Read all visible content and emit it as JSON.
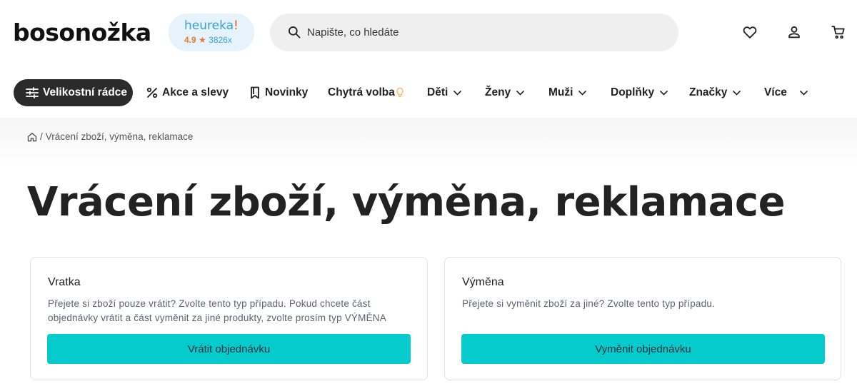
{
  "header": {
    "logo": "bosonožka",
    "heureka": {
      "brand": "heureka",
      "exclamation": "!",
      "rating": "4.9",
      "star": "★",
      "count": "3826x"
    },
    "search": {
      "placeholder": "Napište, co hledáte",
      "value": ""
    },
    "icons": {
      "search": "search-icon",
      "wishlist": "heart-icon",
      "account": "user-icon",
      "cart": "cart-icon"
    }
  },
  "nav": {
    "items": [
      {
        "label": "Velikostní rádce",
        "icon": "sliders-icon"
      },
      {
        "label": "Akce a slevy",
        "icon": "percent-icon"
      },
      {
        "label": "Novinky",
        "icon": "bookmark-icon"
      },
      {
        "label": "Chytrá volba",
        "icon": "bulb-icon"
      },
      {
        "label": "Děti"
      },
      {
        "label": "Ženy"
      },
      {
        "label": "Muži"
      },
      {
        "label": "Doplňky"
      },
      {
        "label": "Značky"
      },
      {
        "label": "Více"
      }
    ]
  },
  "breadcrumb": {
    "separator": "/",
    "current": "Vrácení zboží, výměna, reklamace"
  },
  "page": {
    "title": "Vrácení zboží, výměna, reklamace"
  },
  "cards": [
    {
      "title": "Vratka",
      "description": "Přejete si zboží pouze vrátit? Zvolte tento typ případu. Pokud chcete část objednávky vrátit a část vyměnit za jiné produkty, zvolte prosím typ VÝMĚNA",
      "button": "Vrátit objednávku"
    },
    {
      "title": "Výměna",
      "description": "Přejete si vyměnit zboží za jiné? Zvolte tento typ případu.",
      "button": "Vyměnit objednávku"
    }
  ],
  "colors": {
    "accent": "#05cbcc",
    "dark_pill": "#2b2b2b",
    "heureka_blue": "#3aa0d8",
    "heureka_orange": "#e07a3a"
  }
}
